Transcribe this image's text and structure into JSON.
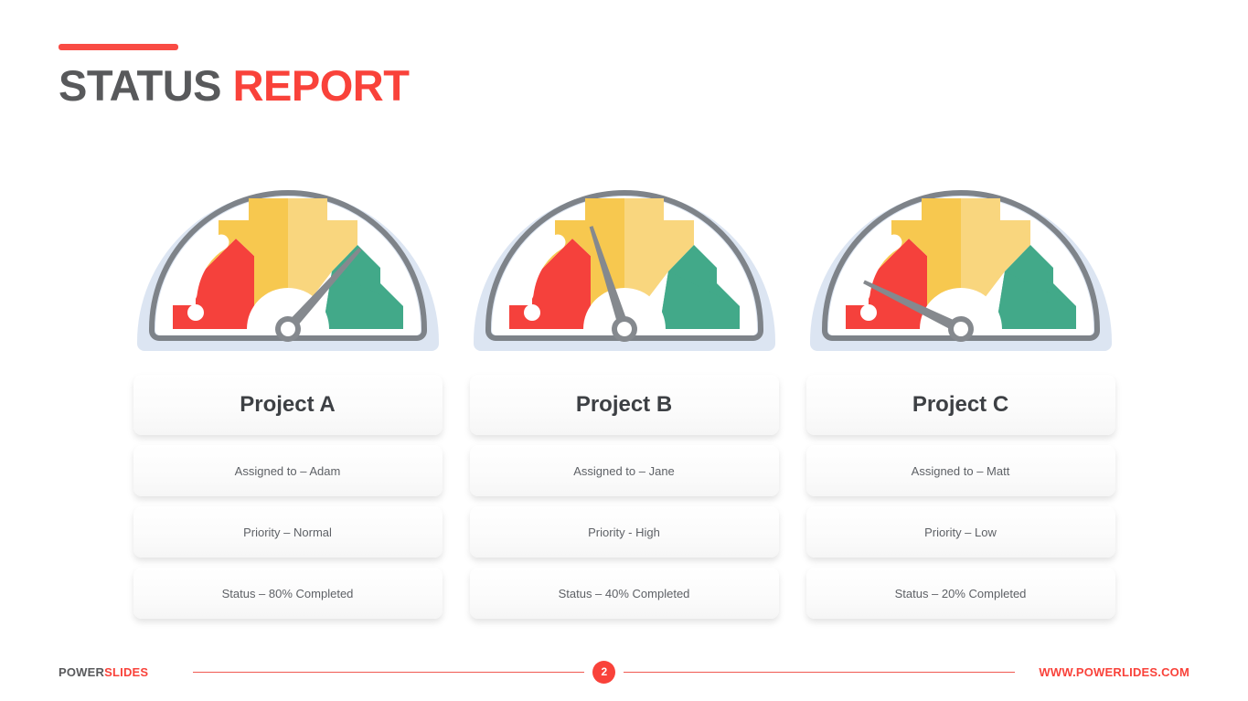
{
  "slide": {
    "title_part1": "STATUS ",
    "title_part2": "REPORT",
    "accent_color": "#f94b44"
  },
  "gauge_style": {
    "shell_color": "#dce5f2",
    "rim_color": "#7e8389",
    "face_color": "#ffffff",
    "red": "#f5413c",
    "amber_dark": "#f7c84f",
    "amber_light": "#f9d67e",
    "green": "#42a989",
    "needle_color": "#85898e"
  },
  "projects": [
    {
      "gauge_name": "gauge-project-a",
      "needle_angle_deg": 48,
      "percent": 80,
      "title": "Project A",
      "assigned": "Assigned to – Adam",
      "priority": "Priority – Normal",
      "status": "Status – 80% Completed"
    },
    {
      "gauge_name": "gauge-project-b",
      "needle_angle_deg": -18,
      "percent": 40,
      "title": "Project B",
      "assigned": "Assigned to – Jane",
      "priority": "Priority - High",
      "status": "Status – 40% Completed"
    },
    {
      "gauge_name": "gauge-project-c",
      "needle_angle_deg": -64,
      "percent": 20,
      "title": "Project C",
      "assigned": "Assigned to – Matt",
      "priority": "Priority – Low",
      "status": "Status – 20% Completed"
    }
  ],
  "footer": {
    "brand_part1": "POWER",
    "brand_part2": "SLIDES",
    "page_number": "2",
    "url": "WWW.POWERLIDES.COM"
  }
}
